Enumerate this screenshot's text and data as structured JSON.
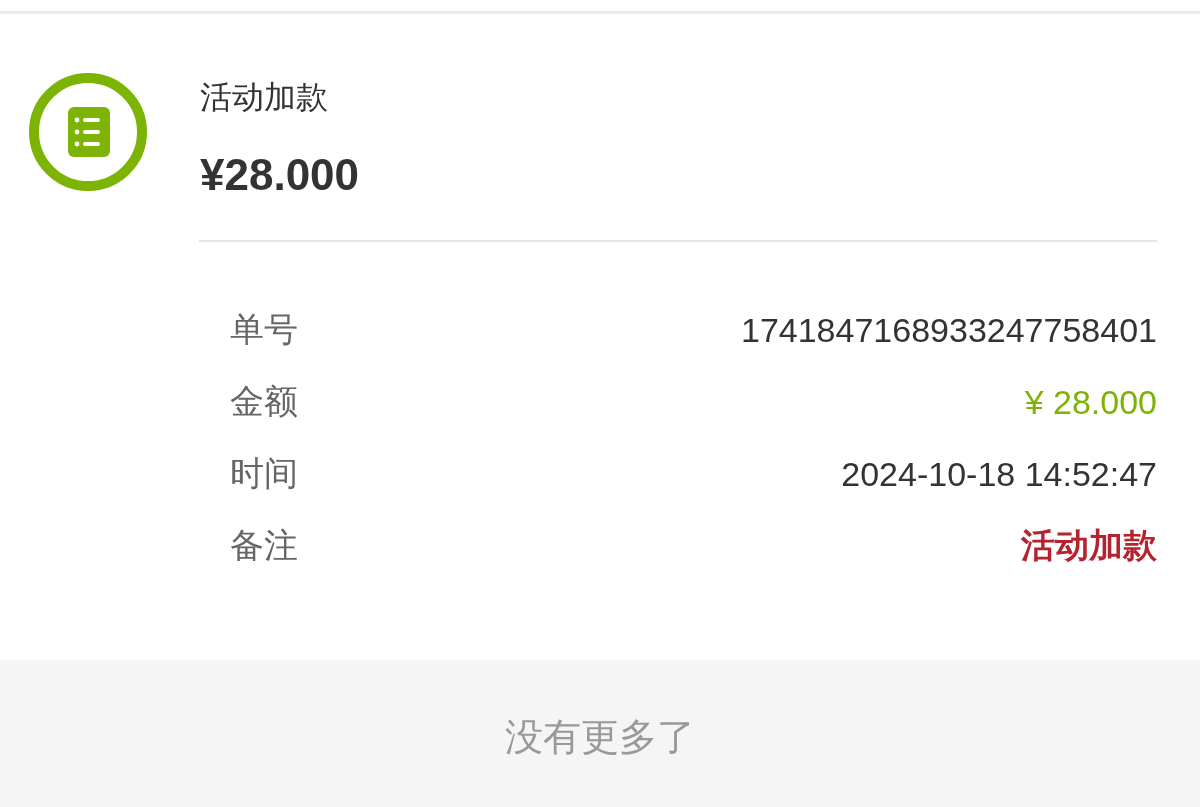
{
  "record": {
    "title": "活动加款",
    "amount": "¥28.000"
  },
  "details": [
    {
      "kind": "plain",
      "label": "单号",
      "value": "1741847168933247758401"
    },
    {
      "kind": "money",
      "label": "金额",
      "value": "¥ 28.000"
    },
    {
      "kind": "plain",
      "label": "时间",
      "value": "2024-10-18 14:52:47"
    },
    {
      "kind": "remark",
      "label": "备注",
      "value": "活动加款"
    }
  ],
  "footer": {
    "text": "没有更多了"
  }
}
